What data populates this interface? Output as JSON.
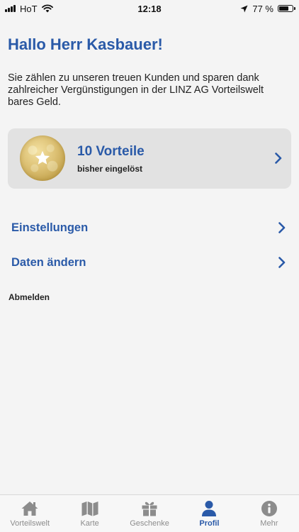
{
  "status_bar": {
    "carrier": "HoT",
    "time": "12:18",
    "battery_text": "77 %",
    "battery_level": 0.77,
    "icons": [
      "signal-icon",
      "wifi-icon",
      "location-arrow-icon",
      "battery-icon"
    ]
  },
  "profile": {
    "greeting": "Hallo Herr Kasbauer!",
    "intro": "Sie zählen zu unseren treuen Kunden und sparen dank zahlreicher Vergünstigungen in der LINZ AG Vorteilswelt bares Geld.",
    "benefits_card": {
      "count_label": "10 Vorteile",
      "sub_label": "bisher eingelöst",
      "icon": "star-medal-icon"
    },
    "menu": [
      {
        "label": "Einstellungen",
        "icon": "chevron-right-icon"
      },
      {
        "label": "Daten ändern",
        "icon": "chevron-right-icon"
      }
    ],
    "logout_label": "Abmelden"
  },
  "tab_bar": {
    "tabs": [
      {
        "label": "Vorteilswelt",
        "icon": "home-icon",
        "active": false
      },
      {
        "label": "Karte",
        "icon": "map-icon",
        "active": false
      },
      {
        "label": "Geschenke",
        "icon": "gift-icon",
        "active": false
      },
      {
        "label": "Profil",
        "icon": "profile-icon",
        "active": true
      },
      {
        "label": "Mehr",
        "icon": "info-icon",
        "active": false
      }
    ]
  },
  "colors": {
    "accent": "#2a5aa8",
    "background": "#f4f4f4",
    "card": "#e2e2e2",
    "tab_inactive": "#8c8c8c"
  }
}
